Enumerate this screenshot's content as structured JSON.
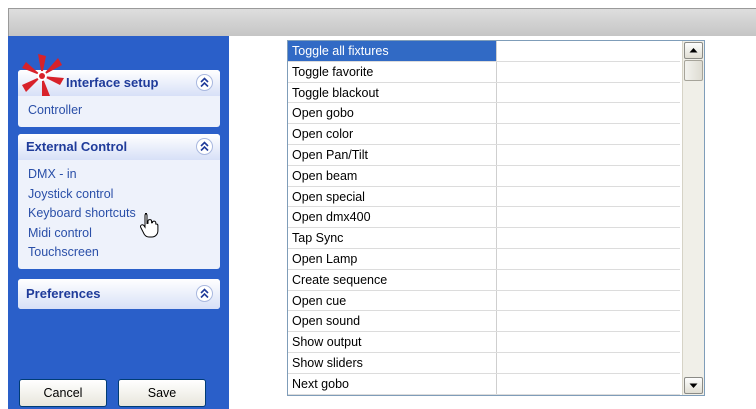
{
  "sidebar": {
    "panels": [
      {
        "title": "Interface setup",
        "items": [
          "Controller"
        ]
      },
      {
        "title": "External Control",
        "items": [
          "DMX - in",
          "Joystick control",
          "Keyboard shortcuts",
          "Midi control",
          "Touchscreen"
        ]
      },
      {
        "title": "Preferences",
        "items": []
      }
    ],
    "cancel_label": "Cancel",
    "save_label": "Save"
  },
  "shortcuts": {
    "rows": [
      "Toggle all fixtures",
      "Toggle favorite",
      "Toggle blackout",
      "Open gobo",
      "Open color",
      "Open Pan/Tilt",
      "Open beam",
      "Open special",
      "Open dmx400",
      "Tap Sync",
      "Open Lamp",
      "Create sequence",
      "Open cue",
      "Open sound",
      "Show output",
      "Show sliders",
      "Next gobo"
    ]
  },
  "colors": {
    "sidebar_bg": "#2a5fc9",
    "panel_title": "#1f3b9a",
    "item_link": "#2a4fa8",
    "selection": "#316ac5",
    "logo_red": "#d8222a"
  },
  "icons": {
    "logo": "starburst-logo-icon",
    "collapse": "double-chevron-up-icon",
    "cursor": "hand-pointer-icon"
  }
}
